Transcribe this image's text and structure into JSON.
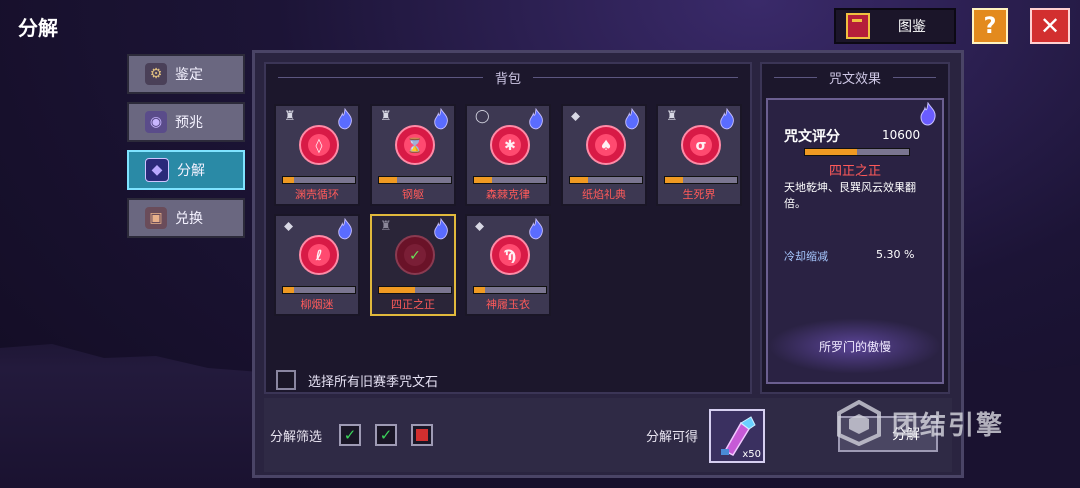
{
  "header": {
    "title": "分解"
  },
  "topbar": {
    "codex_label": "图鉴",
    "help_label": "?",
    "close_label": "✕"
  },
  "sidebar": {
    "tabs": [
      {
        "label": "鉴定",
        "icon": "identify-icon",
        "active": false
      },
      {
        "label": "预兆",
        "icon": "omen-icon",
        "active": false
      },
      {
        "label": "分解",
        "icon": "decompose-icon",
        "active": true
      },
      {
        "label": "兑换",
        "icon": "exchange-icon",
        "active": false
      }
    ]
  },
  "inventory": {
    "title": "背包",
    "items": [
      {
        "name": "渊壳循环",
        "progress": 0.15,
        "type_icon": "armor-icon",
        "selected": false,
        "glyph": "◊"
      },
      {
        "name": "钢躯",
        "progress": 0.25,
        "type_icon": "armor-icon",
        "selected": false,
        "glyph": "⌛"
      },
      {
        "name": "森棘克律",
        "progress": 0.25,
        "type_icon": "ring-icon",
        "selected": false,
        "glyph": "✱"
      },
      {
        "name": "纸焰礼典",
        "progress": 0.25,
        "type_icon": "weapon-icon",
        "selected": false,
        "glyph": "♠"
      },
      {
        "name": "生死界",
        "progress": 0.25,
        "type_icon": "armor-icon",
        "selected": false,
        "glyph": "σ"
      },
      {
        "name": "柳烟迷",
        "progress": 0.15,
        "type_icon": "weapon-icon",
        "selected": false,
        "glyph": "ℓ"
      },
      {
        "name": "四正之正",
        "progress": 0.5,
        "type_icon": "armor-icon",
        "selected": true,
        "glyph": "✓"
      },
      {
        "name": "神履玉衣",
        "progress": 0.15,
        "type_icon": "weapon-icon",
        "selected": false,
        "glyph": "Ϡ"
      }
    ],
    "select_old_label": "选择所有旧赛季咒文石"
  },
  "filter": {
    "label": "分解筛选",
    "boxes": [
      "green-check",
      "green-check",
      "red"
    ]
  },
  "yield": {
    "label": "分解可得",
    "count": "x50"
  },
  "decompose_button": "分解",
  "effect": {
    "title": "咒文效果",
    "score_label": "咒文评分",
    "score_value": "10600",
    "score_progress": 0.5,
    "name": "四正之正",
    "description": "天地乾坤、艮巽风云效果翻倍。",
    "cooldown_label": "冷却缩减",
    "cooldown_value": "5.30 %",
    "set_name": "所罗门的傲慢"
  },
  "watermark": "团结引擎",
  "colors": {
    "accent_active": "#2a8aa6",
    "rune_name": "#ff5a5a",
    "progress": "#f09a22",
    "selected_border": "#e1b93c"
  }
}
